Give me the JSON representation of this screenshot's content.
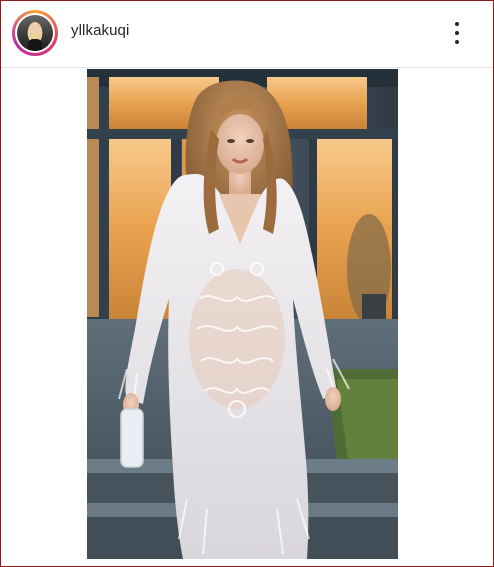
{
  "post": {
    "username": "yllkakuqi",
    "avatar_icon": "profile-avatar-icon",
    "more_icon": "more-options-icon"
  },
  "media": {
    "type": "video",
    "description_icon": "video-frame"
  },
  "colors": {
    "ring_gradient": [
      "#f9a43b",
      "#e0336b",
      "#b22fa8"
    ],
    "frame_border": "#8b1a1a",
    "text": "#262626"
  }
}
